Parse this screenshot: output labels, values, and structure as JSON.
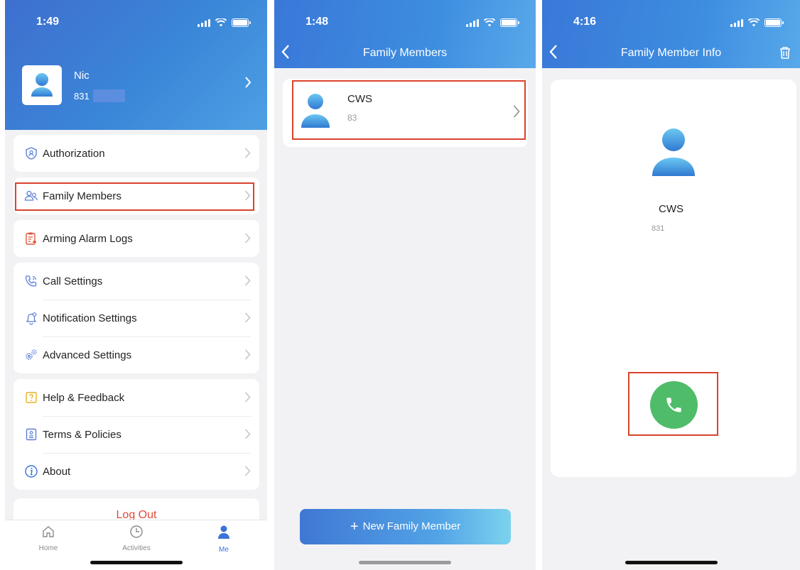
{
  "panel1": {
    "status_time": "1:49",
    "profile": {
      "name": "Nic",
      "phone": "831"
    },
    "menu_groups": [
      [
        {
          "label": "Authorization",
          "icon": "authorization-icon"
        }
      ],
      [
        {
          "label": "Family Members",
          "icon": "family-members-icon"
        }
      ],
      [
        {
          "label": "Arming Alarm Logs",
          "icon": "alarm-log-icon"
        }
      ],
      [
        {
          "label": "Call Settings",
          "icon": "phone-settings-icon"
        },
        {
          "label": "Notification Settings",
          "icon": "bell-icon"
        },
        {
          "label": "Advanced Settings",
          "icon": "gears-icon"
        }
      ],
      [
        {
          "label": "Help & Feedback",
          "icon": "help-icon"
        },
        {
          "label": "Terms & Policies",
          "icon": "document-icon"
        },
        {
          "label": "About",
          "icon": "info-icon"
        }
      ]
    ],
    "logout_label": "Log Out",
    "tabs": [
      {
        "label": "Home",
        "icon": "home-icon",
        "active": false
      },
      {
        "label": "Activities",
        "icon": "clock-icon",
        "active": false
      },
      {
        "label": "Me",
        "icon": "person-icon",
        "active": true
      }
    ]
  },
  "panel2": {
    "status_time": "1:48",
    "title": "Family Members",
    "member": {
      "name": "CWS",
      "phone": "83"
    },
    "new_button_label": "New Family Member"
  },
  "panel3": {
    "status_time": "4:16",
    "title": "Family Member Info",
    "member": {
      "name": "CWS",
      "phone": "831"
    }
  },
  "colors": {
    "header_blue": "#3a86d8",
    "highlight_red": "#d9432c",
    "call_green": "#4fbc69",
    "logout_red": "#e04a3a"
  }
}
